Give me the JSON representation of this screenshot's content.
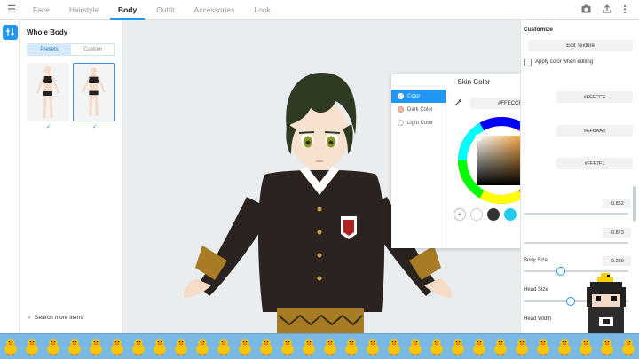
{
  "topbar": {
    "tabs": [
      {
        "label": "Face",
        "active": false
      },
      {
        "label": "Hairstyle",
        "active": false
      },
      {
        "label": "Body",
        "active": true
      },
      {
        "label": "Outfit",
        "active": false
      },
      {
        "label": "Accessories",
        "active": false
      },
      {
        "label": "Look",
        "active": false
      }
    ],
    "icons": [
      "menu-icon",
      "camera-icon",
      "share-icon",
      "more-vertical-icon"
    ]
  },
  "left_panel": {
    "title": "Whole Body",
    "segment": {
      "presets": "Presets",
      "custom": "Custom",
      "selected": "Presets"
    },
    "search_more": "Search more items"
  },
  "skin_color": {
    "title": "Skin Color",
    "items": [
      {
        "label": "Color",
        "selected": true,
        "swatch": "#FFECCF"
      },
      {
        "label": "Dark Color",
        "selected": false,
        "swatch": "#EFBAA3"
      },
      {
        "label": "Light Color",
        "selected": false,
        "swatch": "#FFF7F1"
      }
    ],
    "hex": "#FFECCF",
    "swatches": [
      "#ffffff",
      "#333333",
      "#22ccee",
      "#888888",
      "#ffffff"
    ]
  },
  "customize": {
    "title": "Customize",
    "edit_texture": "Edit Texture",
    "apply_color_label": "Apply color when editing",
    "hex_values": [
      "#FFECCF",
      "#EFBAA3",
      "#FFF7F1"
    ],
    "values": [
      "-0.852",
      "-0.873",
      "-0.289"
    ],
    "body_size_label": "Body Size",
    "head_size_label": "Head Size",
    "head_width_label": "Head Width"
  },
  "colors": {
    "accent": "#2196f3",
    "strip": "#79b8e2"
  }
}
